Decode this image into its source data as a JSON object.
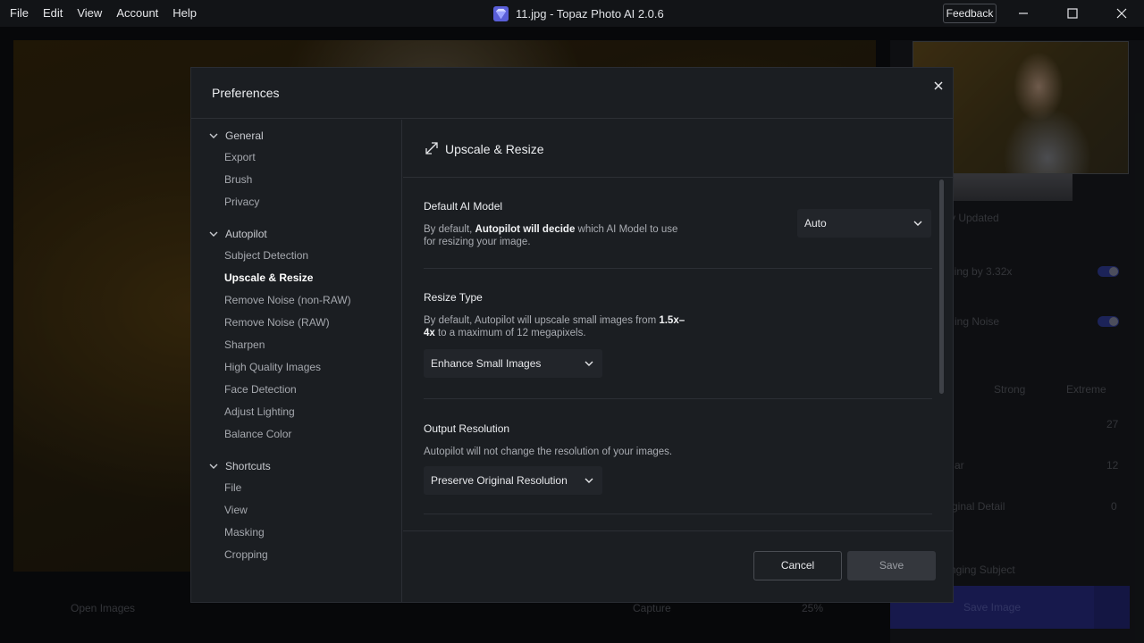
{
  "window": {
    "title": "11.jpg - Topaz Photo AI 2.0.6",
    "menu": [
      "File",
      "Edit",
      "View",
      "Account",
      "Help"
    ],
    "feedback_label": "Feedback"
  },
  "background": {
    "panel_texts": {
      "updated": "v Updated",
      "upscaling": "ling by 3.32x",
      "noise": "ing Noise",
      "strong": "Strong",
      "extreme": "Extreme",
      "val1": "27",
      "val2": "12",
      "val3": "0",
      "blur": "ar",
      "detail": "ginal Detail",
      "subject": "nging Subject"
    },
    "bottom": {
      "open_images": "Open Images",
      "capture": "Capture",
      "zoom": "25%",
      "save_image": "Save Image"
    }
  },
  "modal": {
    "title": "Preferences",
    "sidebar": {
      "general": {
        "label": "General",
        "items": [
          "Export",
          "Brush",
          "Privacy"
        ]
      },
      "autopilot": {
        "label": "Autopilot",
        "items": [
          "Subject Detection",
          "Upscale & Resize",
          "Remove Noise (non-RAW)",
          "Remove Noise (RAW)",
          "Sharpen",
          "High Quality Images",
          "Face Detection",
          "Adjust Lighting",
          "Balance Color"
        ]
      },
      "shortcuts": {
        "label": "Shortcuts",
        "items": [
          "File",
          "View",
          "Masking",
          "Cropping"
        ]
      },
      "active": "Upscale & Resize"
    },
    "section": {
      "title": "Upscale & Resize",
      "default_model": {
        "label": "Default AI Model",
        "desc_prefix": "By default, ",
        "desc_bold": "Autopilot will decide",
        "desc_suffix": " which AI Model to use",
        "desc_line2": "for resizing your image.",
        "value": "Auto"
      },
      "resize_type": {
        "label": "Resize Type",
        "desc_prefix": "By default, Autopilot will upscale small images from ",
        "desc_bold1": "1.5x–",
        "desc_bold2": "4x",
        "desc_suffix": " to a maximum of 12 megapixels.",
        "value": "Enhance Small Images"
      },
      "output_resolution": {
        "label": "Output Resolution",
        "desc": "Autopilot will not change the resolution of your images.",
        "value": "Preserve Original Resolution"
      }
    },
    "buttons": {
      "cancel": "Cancel",
      "save": "Save"
    }
  }
}
